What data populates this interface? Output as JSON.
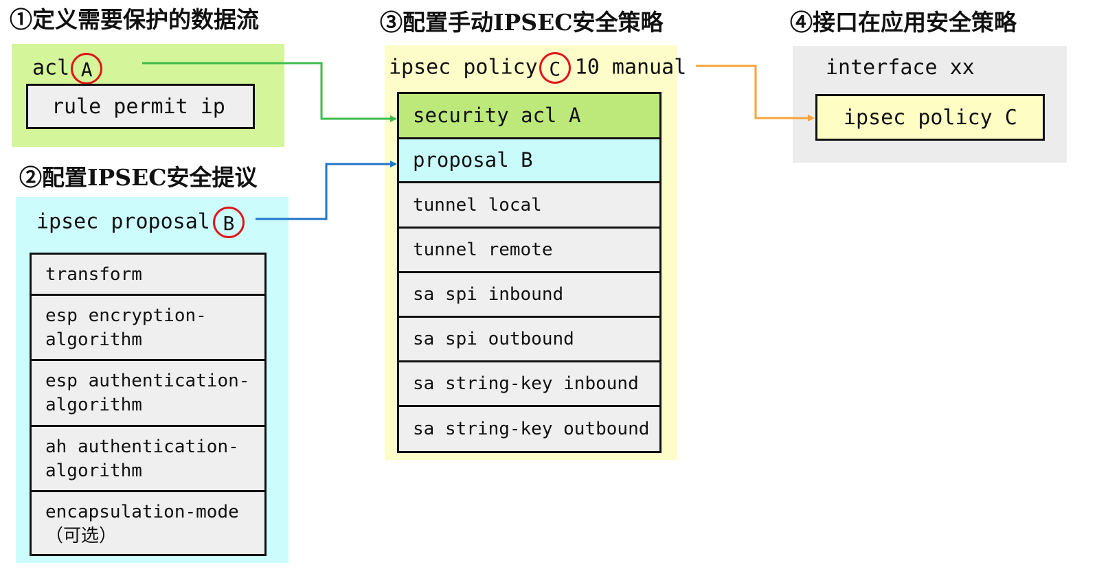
{
  "colors": {
    "panel1_bg": "#d4f59a",
    "panel2_bg": "#ccfcfc",
    "panel3_bg": "#fdfdc9",
    "panel4_bg": "#ececec",
    "row_green": "#bce97a",
    "row_cyan": "#c9fbfb",
    "row_gray": "#efefef",
    "row_yellow": "#fdfdc4",
    "circle_red": "#e0161b",
    "arrow_green": "#3dbb4a",
    "arrow_blue": "#1f74c8",
    "arrow_orange": "#f7a33a"
  },
  "step1": {
    "title": "①定义需要保护的数据流",
    "acl_keyword": "acl",
    "acl_name": "A",
    "rule": "rule permit ip"
  },
  "step2": {
    "title": "②配置IPSEC安全提议",
    "proposal_keyword": "ipsec proposal",
    "proposal_name": "B",
    "items": [
      "transform",
      "esp encryption-algorithm",
      "esp authentication-algorithm",
      "ah authentication-algorithm",
      "encapsulation-mode （可选）"
    ]
  },
  "step3": {
    "title": "③配置手动IPSEC安全策略",
    "policy_keyword": "ipsec policy",
    "policy_name": "C",
    "policy_suffix": "10 manual",
    "items": [
      "security acl A",
      "proposal B",
      "tunnel local",
      "tunnel remote",
      "sa spi inbound",
      "sa spi outbound",
      "sa string-key inbound",
      "sa string-key outbound"
    ]
  },
  "step4": {
    "title": "④接口在应用安全策略",
    "interface_line": "interface xx",
    "applied_policy": "ipsec policy C"
  }
}
